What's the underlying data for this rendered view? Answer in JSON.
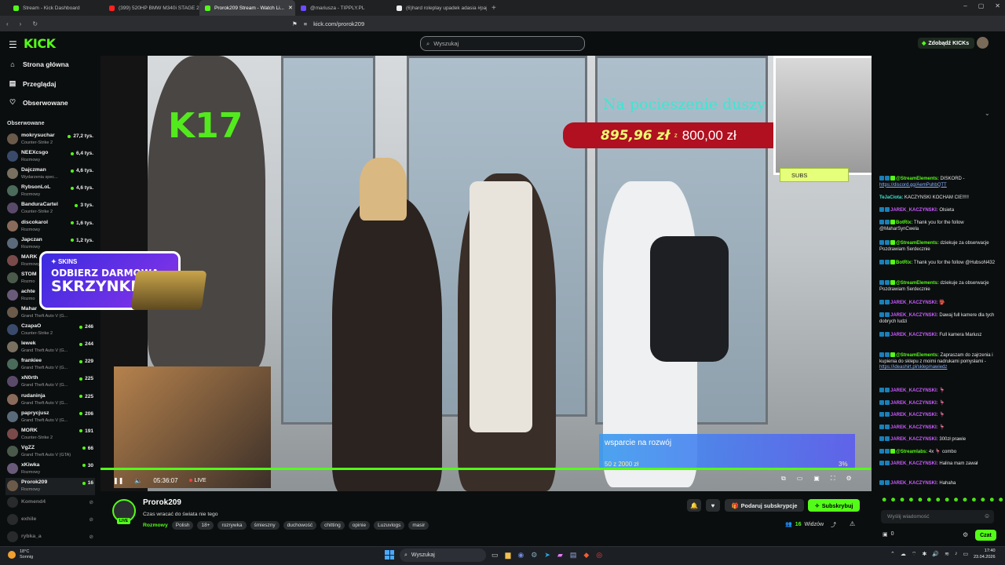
{
  "browser": {
    "tabs": [
      {
        "label": "Stream - Kick Dashboard",
        "color": "#53fc18",
        "active": false
      },
      {
        "label": "(399) 520HP BMW M340i STAGE 2 //",
        "color": "#ff2020",
        "active": false
      },
      {
        "label": "Prorok209 Stream - Watch Li...",
        "color": "#53fc18",
        "active": true
      },
      {
        "label": "@mariusza - TIPPLY.PL",
        "color": "#6d4cff",
        "active": false
      },
      {
        "label": "(6)hard roleplay upadek adasia #pajac",
        "color": "#eeeeee",
        "active": false
      }
    ],
    "new_tab": "+",
    "url": "kick.com/prorok209"
  },
  "header": {
    "logo": "KICK",
    "search_placeholder": "Wyszukaj",
    "get_kicks": "Zdobądź KICKs"
  },
  "sidebar": {
    "nav": [
      {
        "label": "Strona główna",
        "icon": "home-icon"
      },
      {
        "label": "Przeglądaj",
        "icon": "browse-icon"
      },
      {
        "label": "Obserwowane",
        "icon": "heart-icon"
      }
    ],
    "followed_title": "Obserwowane",
    "channels": [
      {
        "name": "mokrysuchar",
        "game": "Counter-Strike 2",
        "viewers": "27,2 tys."
      },
      {
        "name": "NEEXcsgo",
        "game": "Rozmowy",
        "viewers": "6,4 tys."
      },
      {
        "name": "Dajczman",
        "game": "Wydarzenia spec...",
        "viewers": "4,6 tys."
      },
      {
        "name": "RybsonLoL",
        "game": "Rozmowy",
        "viewers": "4,6 tys."
      },
      {
        "name": "BanduraCartel",
        "game": "Counter-Strike 2",
        "viewers": "3 tys."
      },
      {
        "name": "discokarol",
        "game": "Rozmowy",
        "viewers": "1,6 tys."
      },
      {
        "name": "Japczan",
        "game": "Rozmowy",
        "viewers": "1,2 tys."
      },
      {
        "name": "MARK",
        "game": "Rozmowy",
        "viewers": ""
      },
      {
        "name": "STOM",
        "game": "Rozmo",
        "viewers": ""
      },
      {
        "name": "achte",
        "game": "Rozmo",
        "viewers": ""
      },
      {
        "name": "Mahar",
        "game": "Grand Theft Auto V (G...",
        "viewers": ""
      },
      {
        "name": "CzapaO",
        "game": "Counter-Strike 2",
        "viewers": "246"
      },
      {
        "name": "lewek",
        "game": "Grand Theft Auto V (G...",
        "viewers": "244"
      },
      {
        "name": "frankiee",
        "game": "Grand Theft Auto V (G...",
        "viewers": "229"
      },
      {
        "name": "xN0rth",
        "game": "Grand Theft Auto V (G...",
        "viewers": "225"
      },
      {
        "name": "rudaninja",
        "game": "Grand Theft Auto V (G...",
        "viewers": "225"
      },
      {
        "name": "paprycjusz",
        "game": "Grand Theft Auto V (G...",
        "viewers": "206"
      },
      {
        "name": "MORK",
        "game": "Counter-Strike 2",
        "viewers": "191"
      },
      {
        "name": "VgZZ",
        "game": "Grand Theft Auto V (GTA)",
        "viewers": "66"
      },
      {
        "name": "xKiwka",
        "game": "Rozmowy",
        "viewers": "30"
      },
      {
        "name": "Prorok209",
        "game": "Rozmowy",
        "viewers": "16"
      }
    ],
    "offline": [
      {
        "name": "Komend4"
      },
      {
        "name": "exhile"
      },
      {
        "name": "rybka_a"
      }
    ]
  },
  "video": {
    "overlay_k17": "17",
    "donation_title": "Na pocieszenie duszy",
    "donation_amount": "895,96 zł",
    "donation_sep": "z",
    "donation_goal": "800,00 zł",
    "promo_brand": "SKINS",
    "promo_line1": "ODBIERZ DARMOWĄ",
    "promo_line2": "SKRZYNKĘ!",
    "goal_title": "wsparcie na rozwój",
    "goal_numbers": "50 z 2000 zł",
    "goal_percent": "3%",
    "subs_label": "SUBS",
    "time": "05:36:07",
    "live": "LIVE",
    "progress": 1.0
  },
  "stream": {
    "name": "Prorok209",
    "title": "Czas wracać do świata nie tego",
    "category": "Rozmowy",
    "live_badge": "LIVE",
    "tags": [
      "Polish",
      "18+",
      "rozrywka",
      "śmieszny",
      "duchowość",
      "chitting",
      "opinie",
      "Luzuvlogs",
      "masir"
    ],
    "gift_label": "Podaruj subskrypcje",
    "subscribe_label": "Subskrybuj",
    "viewers_count": "16",
    "viewers_label": "Widzów"
  },
  "chat": {
    "messages": [
      {
        "user": "@StreamElements:",
        "text": "DISKORD -",
        "link": "https://discord.gg/AemPuhbQTT",
        "color": "#53fc18"
      },
      {
        "user": "TeJaCiota:",
        "text": "KACZYNSKI KOCHAM CIE!!!!!",
        "link": "",
        "color": "#3de6d2"
      },
      {
        "user": "JAREK_KACZYNSKI:",
        "text": "Olsieta",
        "link": "",
        "color": "#c95cff"
      },
      {
        "user": "BotRix:",
        "text": "Thank you for the follow @MaharSynCwela",
        "link": "",
        "color": "#53fc18"
      },
      {
        "user": "@StreamElements:",
        "text": "dziekuje za obserwacje Pozdrawiam Serdecznie",
        "link": "",
        "color": "#53fc18"
      },
      {
        "user": "BotRix:",
        "text": "Thank you for the follow @HubsoN432",
        "link": "",
        "color": "#53fc18"
      },
      {
        "user": "@StreamElements:",
        "text": "dziekuje za obserwacje Pozdrawiam Serdecznie",
        "link": "",
        "color": "#53fc18"
      },
      {
        "user": "JAREK_KACZYNSKI:",
        "text": "👺",
        "link": "",
        "color": "#c95cff"
      },
      {
        "user": "JAREK_KACZYNSKI:",
        "text": "Dawaj full kamere dla tych dobrych ludzi",
        "link": "",
        "color": "#c95cff"
      },
      {
        "user": "JAREK_KACZYNSKI:",
        "text": "Full kamera Mariusz",
        "link": "",
        "color": "#c95cff"
      },
      {
        "user": "@StreamElements:",
        "text": "Zapraszam do zajrzenia i kupienia do sklepu z moimi nadrukami pomysłami -",
        "link": "https://ideashirt.pl/sklep/nawiedz",
        "color": "#53fc18"
      },
      {
        "user": "JAREK_KACZYNSKI:",
        "text": "🦩",
        "link": "",
        "color": "#c95cff"
      },
      {
        "user": "JAREK_KACZYNSKI:",
        "text": "🦩",
        "link": "",
        "color": "#c95cff"
      },
      {
        "user": "JAREK_KACZYNSKI:",
        "text": "🦩",
        "link": "",
        "color": "#c95cff"
      },
      {
        "user": "JAREK_KACZYNSKI:",
        "text": "🦩",
        "link": "",
        "color": "#c95cff"
      },
      {
        "user": "JAREK_KACZYNSKI:",
        "text": "300zł prawie",
        "link": "",
        "color": "#c95cff"
      },
      {
        "user": "@Streamlabs:",
        "text": "4x 🦩 combo",
        "link": "",
        "color": "#53fc18"
      },
      {
        "user": "JAREK_KACZYNSKI:",
        "text": "Halina mam zawał",
        "link": "",
        "color": "#c95cff"
      },
      {
        "user": "JAREK_KACZYNSKI:",
        "text": "Hahaha",
        "link": "",
        "color": "#c95cff"
      }
    ],
    "input_placeholder": "Wyślij wiadomość",
    "points": "0",
    "send_label": "Czat"
  },
  "taskbar": {
    "weather_temp": "18°C",
    "weather_desc": "Sonnig",
    "search_placeholder": "Wyszukaj",
    "time": "17:40",
    "date": "23.04.2026"
  }
}
